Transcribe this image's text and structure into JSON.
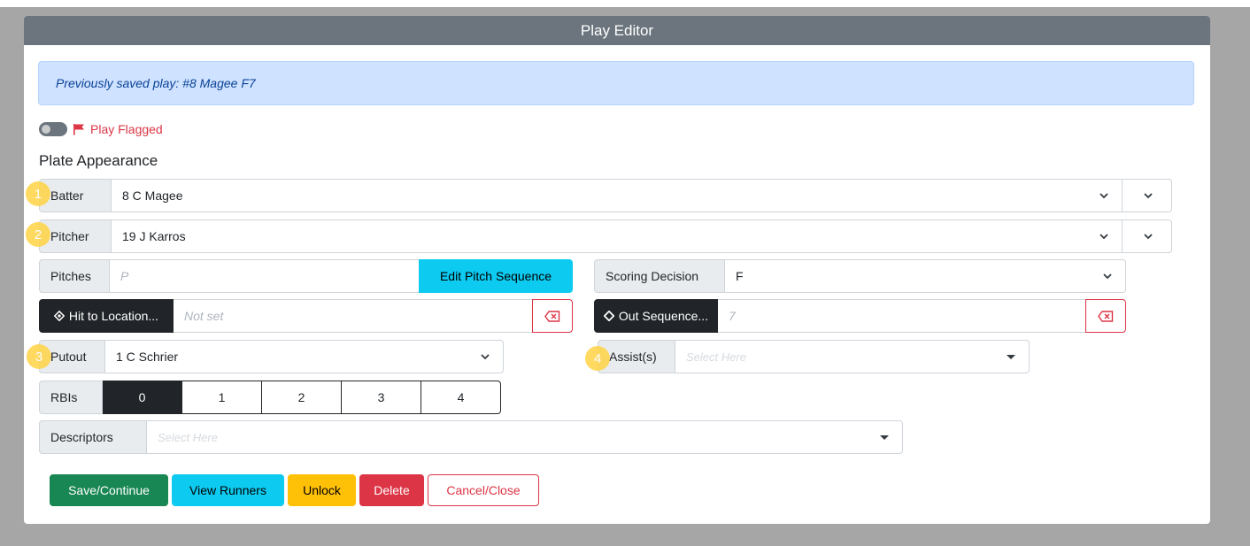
{
  "modal": {
    "title": "Play Editor"
  },
  "alert": {
    "text": "Previously saved play: #8 Magee F7"
  },
  "flag": {
    "label": "Play Flagged"
  },
  "section": {
    "title": "Plate Appearance"
  },
  "steps": [
    "1",
    "2",
    "3",
    "4"
  ],
  "batter": {
    "label": "Batter",
    "value": "8 C Magee"
  },
  "pitcher": {
    "label": "Pitcher",
    "value": "19 J Karros"
  },
  "pitches": {
    "label": "Pitches",
    "placeholder": "P",
    "button": "Edit Pitch Sequence"
  },
  "scoring": {
    "label": "Scoring Decision",
    "value": "F"
  },
  "hit_location": {
    "button": "Hit to Location...",
    "value": "Not set"
  },
  "out_sequence": {
    "button": "Out Sequence...",
    "value": "7"
  },
  "putout": {
    "label": "Putout",
    "value": "1 C Schrier"
  },
  "assists": {
    "label": "Assist(s)",
    "placeholder": "Select Here"
  },
  "rbis": {
    "label": "RBIs",
    "options": [
      "0",
      "1",
      "2",
      "3",
      "4"
    ],
    "selected": "0"
  },
  "descriptors": {
    "label": "Descriptors",
    "placeholder": "Select Here"
  },
  "footer": {
    "save": "Save/Continue",
    "view_runners": "View Runners",
    "unlock": "Unlock",
    "delete": "Delete",
    "cancel": "Cancel/Close"
  },
  "icons": {
    "flag": "flag-icon",
    "crosshair": "crosshair-icon",
    "diamond": "diamond-icon",
    "clear": "backspace-icon",
    "caret": "chevron-down-icon"
  },
  "colors": {
    "header": "#6c757d",
    "info": "#0dcaf0",
    "success": "#198754",
    "warning": "#ffc107",
    "danger": "#dc3545",
    "dark": "#212529",
    "alert_bg": "#cfe2ff",
    "step_badge": "#ffd54f"
  }
}
